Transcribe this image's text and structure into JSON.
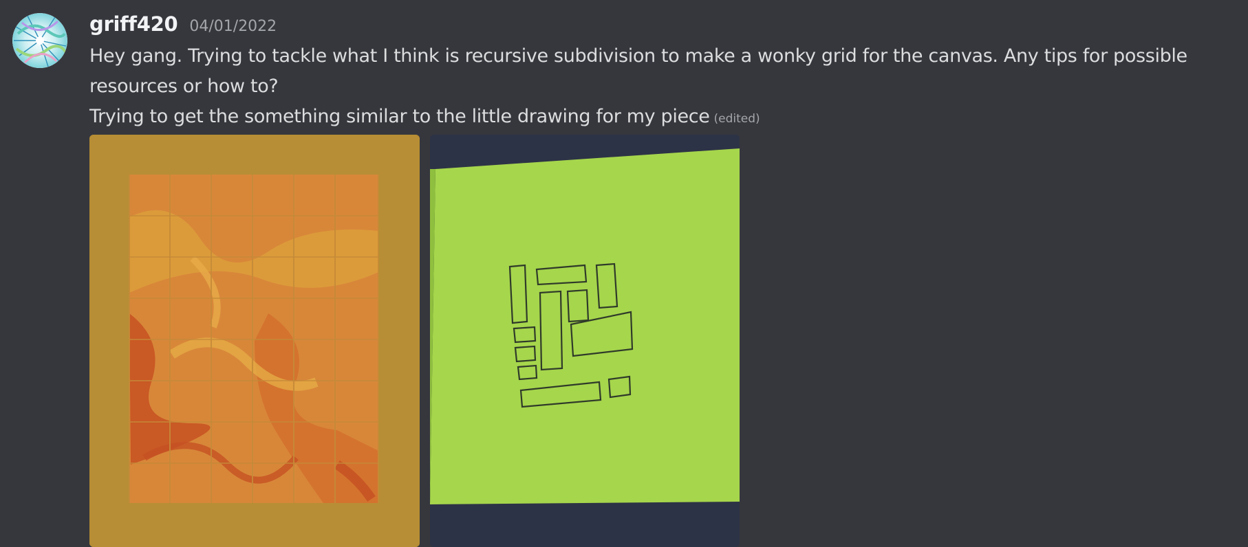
{
  "message": {
    "username": "griff420",
    "timestamp": "04/01/2022",
    "lines": [
      "Hey gang. Trying to tackle what I think is recursive subdivision to make a wonky grid for the canvas. Any tips for possible resources or how to?",
      "Trying to get the something similar to the little drawing for my piece"
    ],
    "edited_label": "(edited)"
  },
  "avatar": {
    "icon": "marbled-swirl-avatar"
  },
  "attachments": [
    {
      "name": "marbled-grid-artwork",
      "colors": {
        "frame": "#b88e35",
        "swirl_red": "#c9441f",
        "swirl_orange": "#e07a30"
      }
    },
    {
      "name": "sticky-note-sketch",
      "colors": {
        "note": "#a6d64c",
        "ink": "#2f3a2a",
        "background": "#2d3346"
      }
    }
  ]
}
